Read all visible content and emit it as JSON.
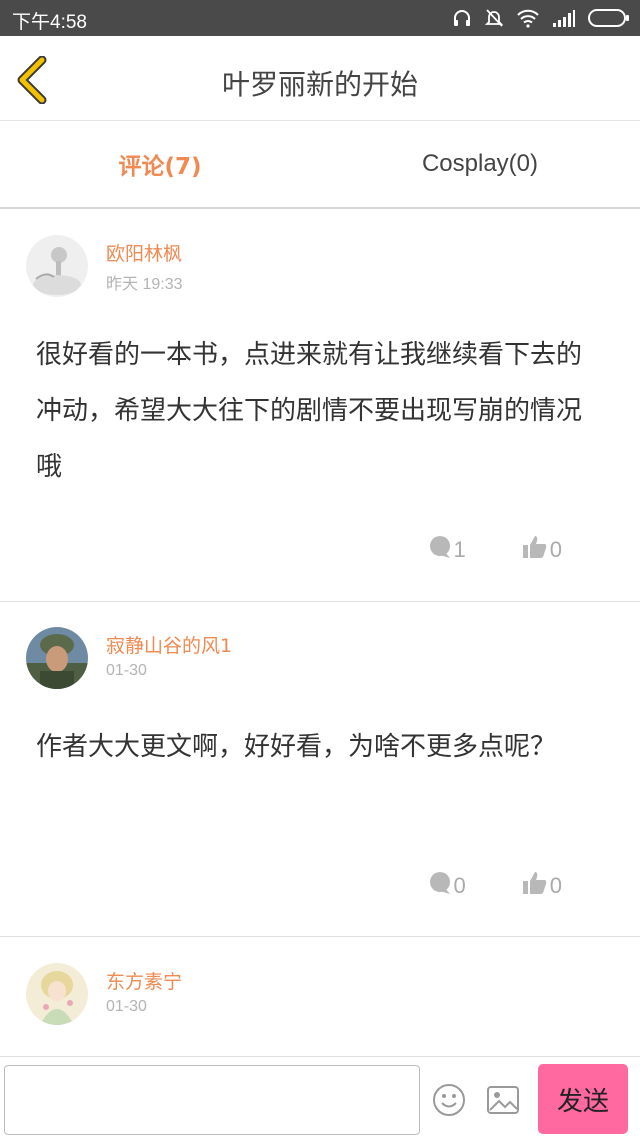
{
  "status_bar": {
    "time": "下午4:58",
    "icons": [
      "headphones-icon",
      "mute-bell-icon",
      "wifi-icon",
      "signal-icon",
      "battery-icon"
    ]
  },
  "header": {
    "title": "叶罗丽新的开始",
    "back_icon": "chevron-left-icon",
    "accent_color": "#e8b400"
  },
  "tabs": [
    {
      "label": "评论(7)",
      "active": true
    },
    {
      "label": "Cosplay(0)",
      "active": false
    }
  ],
  "comments": [
    {
      "username": "欧阳林枫",
      "time": "昨天 19:33",
      "text": "很好看的一本书，点进来就有让我继续看下去的冲动，希望大大往下的剧情不要出现写崩的情况哦",
      "replies": "1",
      "likes": "0"
    },
    {
      "username": "寂静山谷的风1",
      "time": "01-30",
      "text": "作者大大更文啊，好好看，为啥不更多点呢？",
      "replies": "0",
      "likes": "0"
    },
    {
      "username": "东方素宁",
      "time": "01-30",
      "text": "",
      "replies": "",
      "likes": ""
    }
  ],
  "input_bar": {
    "value": "",
    "emoji_icon": "emoji-icon",
    "image_icon": "image-icon",
    "send_label": "发送",
    "send_color": "#ff69a0"
  },
  "colors": {
    "username": "#ef8a52",
    "active_tab": "#f08a52",
    "status_bar": "#4a4a4a"
  }
}
